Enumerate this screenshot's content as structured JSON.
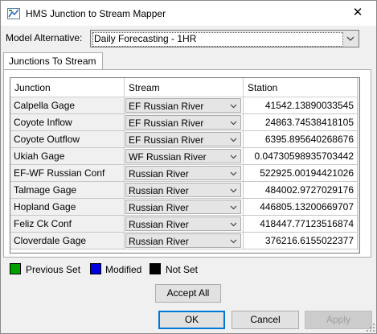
{
  "window": {
    "title": "HMS Junction to Stream Mapper",
    "close_glyph": "✕"
  },
  "model_alternative": {
    "label": "Model Alternative:",
    "value": "Daily Forecasting - 1HR"
  },
  "tabs": [
    {
      "label": "Junctions To Stream"
    }
  ],
  "table": {
    "columns": [
      "Junction",
      "Stream",
      "Station"
    ],
    "rows": [
      {
        "junction": "Calpella Gage",
        "stream": "EF Russian River",
        "station": "41542.13890033545"
      },
      {
        "junction": "Coyote Inflow",
        "stream": "EF Russian River",
        "station": "24863.74538418105"
      },
      {
        "junction": "Coyote Outflow",
        "stream": "EF Russian River",
        "station": "6395.895640268676"
      },
      {
        "junction": "Ukiah Gage",
        "stream": "WF Russian River",
        "station": "0.04730598935703442"
      },
      {
        "junction": "EF-WF Russian Conf",
        "stream": "Russian River",
        "station": "522925.00194421026"
      },
      {
        "junction": "Talmage Gage",
        "stream": "Russian River",
        "station": "484002.9727029176"
      },
      {
        "junction": "Hopland Gage",
        "stream": "Russian River",
        "station": "446805.13200669707"
      },
      {
        "junction": "Feliz Ck Conf",
        "stream": "Russian River",
        "station": "418447.77123516874"
      },
      {
        "junction": "Cloverdale Gage",
        "stream": "Russian River",
        "station": "376216.6155022377"
      }
    ]
  },
  "legend": [
    {
      "label": "Previous Set",
      "color": "#00a000"
    },
    {
      "label": "Modified",
      "color": "#0000e0"
    },
    {
      "label": "Not Set",
      "color": "#000000"
    }
  ],
  "buttons": {
    "accept_all": "Accept All",
    "ok": "OK",
    "cancel": "Cancel",
    "apply": "Apply"
  },
  "icons": {
    "app": "hms-app-icon",
    "close": "close-icon",
    "dropdown": "chevron-down-icon",
    "scroll_up": "scroll-up-arrow-icon",
    "scroll_down": "scroll-down-arrow-icon",
    "resize": "resize-grip-icon"
  }
}
